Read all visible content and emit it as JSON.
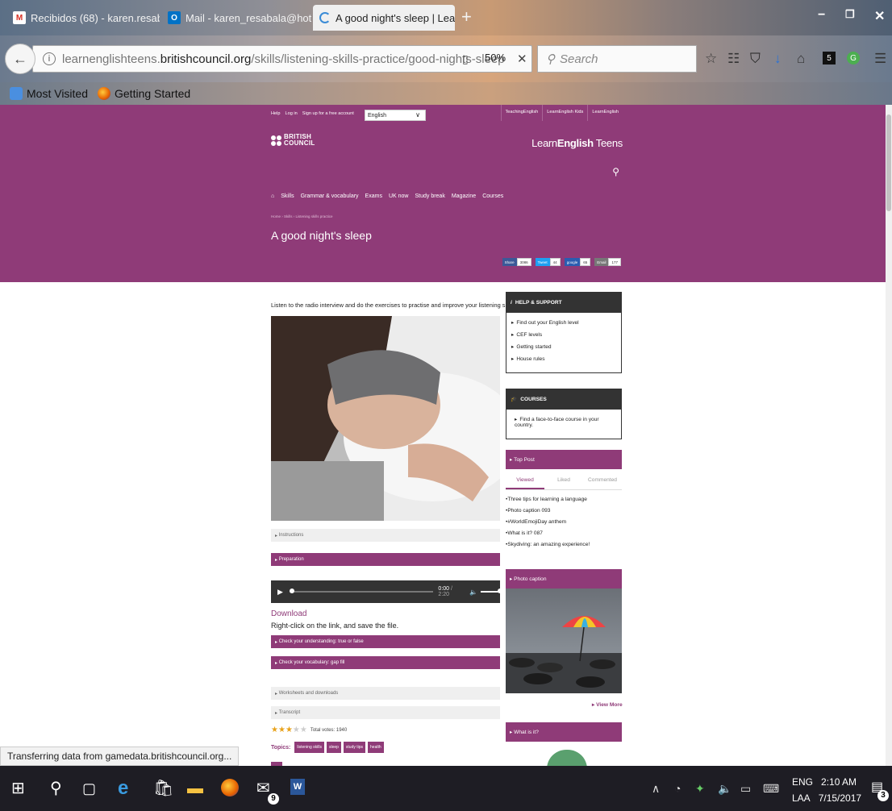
{
  "browser": {
    "tabs": [
      {
        "title": "Recibidos (68) - karen.resab",
        "icon": "gmail-icon",
        "active": false
      },
      {
        "title": "Mail - karen_resabala@hotm",
        "icon": "outlook-icon",
        "active": false
      },
      {
        "title": "A good night's sleep | Learn",
        "icon": "loading-icon",
        "active": true
      }
    ],
    "new_tab": "+",
    "url_prefix": "learnenglishteens.",
    "url_domain": "britishcouncil.org",
    "url_path": "/skills/listening-skills-practice/good-nights-sleep",
    "zoom": "50%",
    "search_placeholder": "Search",
    "bookmarks": [
      "Most Visited",
      "Getting Started"
    ],
    "status_text": "Transferring data from gamedata.britishcouncil.org..."
  },
  "site": {
    "top_links": [
      "Help",
      "Log in",
      "Sign up for a free account"
    ],
    "language": "English",
    "site_links": [
      "TeachingEnglish",
      "LearnEnglish Kids",
      "LearnEnglish"
    ],
    "org_line1": "BRITISH",
    "org_line2": "COUNCIL",
    "brand_pre": "Learn",
    "brand_bold": "English",
    "brand_post": " Teens",
    "nav": [
      "Skills",
      "Grammar & vocabulary",
      "Exams",
      "UK now",
      "Study break",
      "Magazine",
      "Courses"
    ],
    "breadcrumb": "Home › Skills › Listening skills practice",
    "page_title": "A good night's sleep",
    "share": [
      {
        "label": "Share",
        "count": "3086",
        "color": "#3b5998"
      },
      {
        "label": "Tweet",
        "count": "44",
        "color": "#1da1f2"
      },
      {
        "label": "google",
        "count": "65",
        "color": "#2a5db0"
      },
      {
        "label": "Email",
        "count": "177",
        "color": "#777777"
      }
    ]
  },
  "content": {
    "lead": "Listen to the radio interview and do the exercises to practise and improve your listening skills.",
    "instructions": "Instructions",
    "preparation": "Preparation",
    "player": {
      "current": "0:00",
      "duration": "2:20",
      "progress": 0
    },
    "download": "Download",
    "right_click": "Right-click on the link, and save the file.",
    "check_understanding": "Check your understanding: true or false",
    "check_vocabulary": "Check your vocabulary: gap fill",
    "worksheets": "Worksheets and downloads",
    "transcript": "Transcript",
    "rating": {
      "stars": 3,
      "max": 5,
      "votes": "Total votes: 1940"
    },
    "topics_label": "Topics:",
    "topics": [
      "listening skills",
      "sleep",
      "study tips",
      "health"
    ]
  },
  "sidebar": {
    "help_title": "HELP & SUPPORT",
    "help_items": [
      "Find out your English level",
      "CEF levels",
      "Getting started",
      "House rules"
    ],
    "courses_title": "COURSES",
    "courses_items": [
      "Find a face-to-face course in your country."
    ],
    "top_post": "Top Post",
    "tabs": [
      "Viewed",
      "Liked",
      "Commented"
    ],
    "top_list": [
      "Three tips for learning a language",
      "Photo caption 093",
      "#WorldEmojiDay anthem",
      "What is it? 087",
      "Skydiving: an amazing experience!"
    ],
    "photo_caption": "Photo caption",
    "view_more": "View More",
    "what_is_it": "What is it?"
  },
  "taskbar": {
    "language": "ENG",
    "layout": "LAA",
    "time": "2:10 AM",
    "date": "7/15/2017",
    "mail_badge": "9",
    "notification_count": "3"
  },
  "colors": {
    "accent": "#8f3b78",
    "dark": "#333333"
  }
}
